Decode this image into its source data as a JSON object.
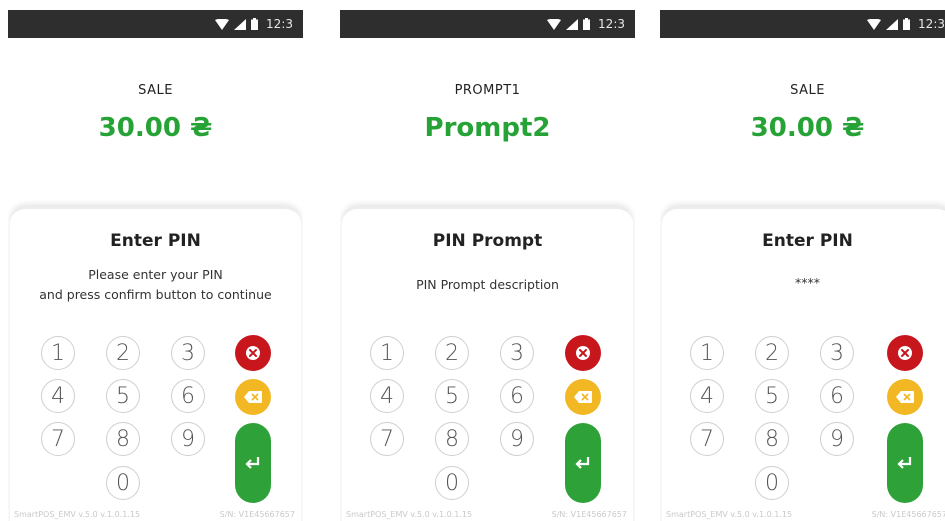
{
  "status_bar": {
    "time": "12:3"
  },
  "footer": {
    "left": "SmartPOS_EMV v.5.0 v.1.0.1.15",
    "right": "S/N: V1E45667657"
  },
  "keypad": {
    "digits": [
      "1",
      "2",
      "3",
      "4",
      "5",
      "6",
      "7",
      "8",
      "9",
      "0"
    ],
    "cancel_icon": "cancel-x-icon",
    "clear_icon": "backspace-icon",
    "enter_icon": "enter-return-icon"
  },
  "colors": {
    "amount_green": "#27a236",
    "cancel_red": "#c8161d",
    "clear_yellow": "#f2b824",
    "enter_green": "#2ea238",
    "status_bar": "#2e2e2e"
  },
  "screens": [
    {
      "label": "SALE",
      "amount": "30.00 ₴",
      "title": "Enter PIN",
      "desc_lines": [
        "Please enter your PIN",
        "and press confirm button to continue"
      ]
    },
    {
      "label": "PROMPT1",
      "amount": "Prompt2",
      "title": "PIN Prompt",
      "desc_lines": [
        "PIN Prompt description",
        ""
      ]
    },
    {
      "label": "SALE",
      "amount": "30.00 ₴",
      "title": "Enter PIN",
      "desc_lines": [
        "****",
        ""
      ]
    }
  ]
}
